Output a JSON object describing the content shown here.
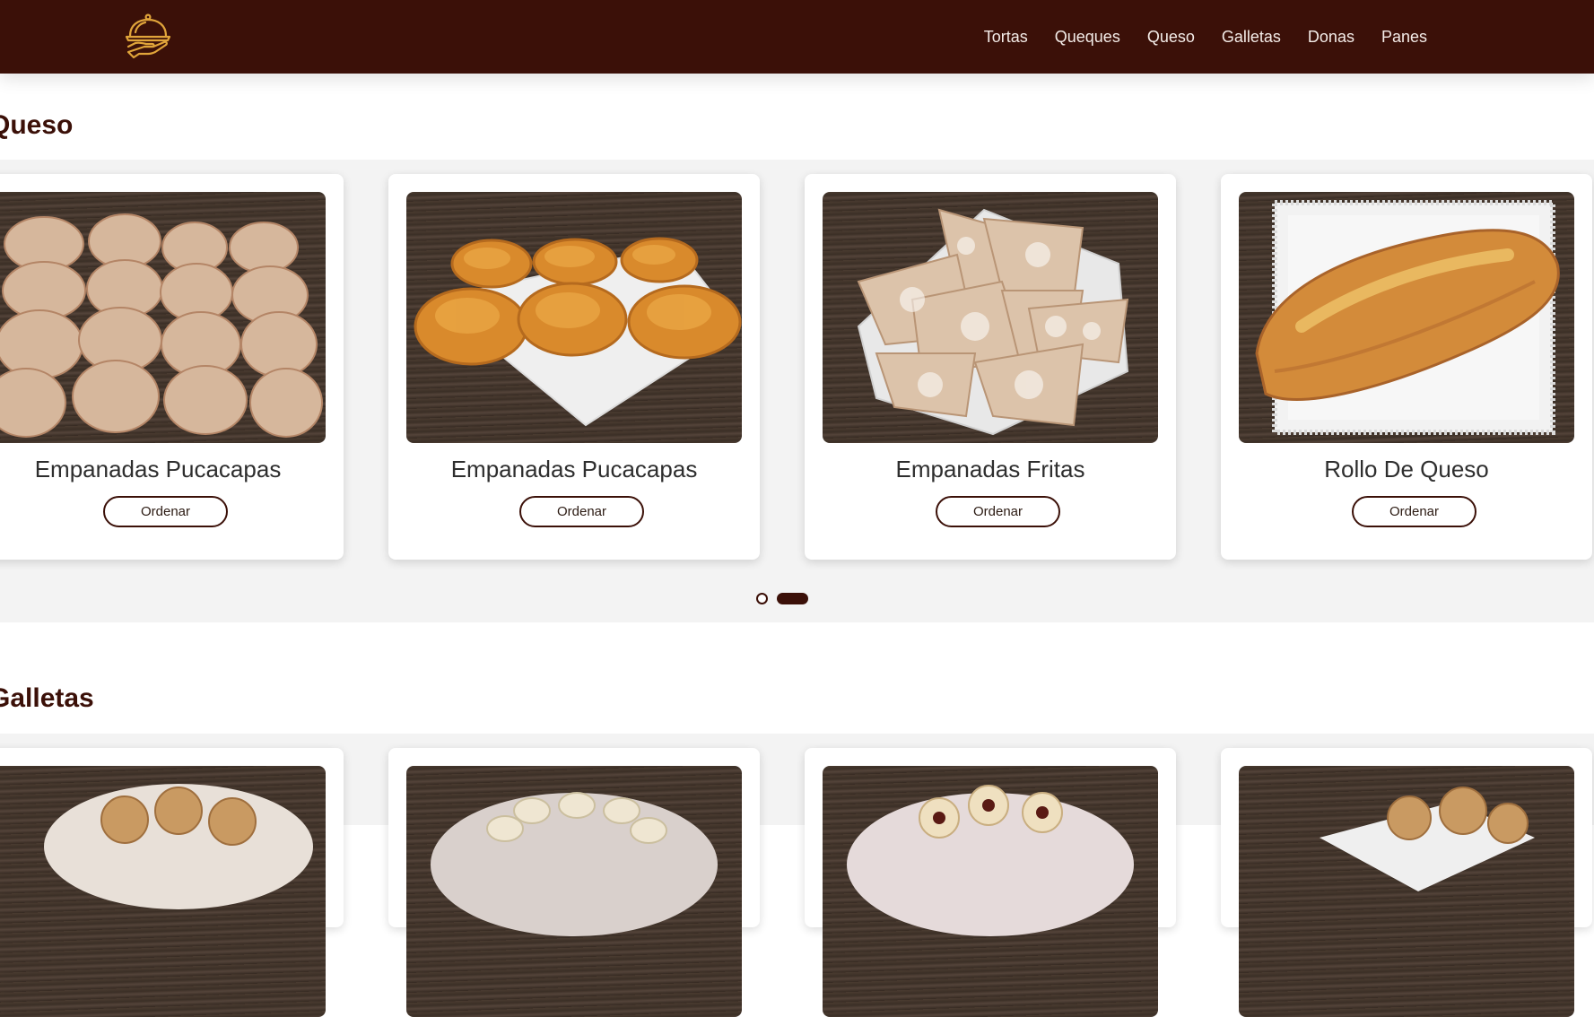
{
  "brand": {
    "logo_icon": "cloche-serving-icon",
    "logo_color": "#e0a43a"
  },
  "nav": {
    "items": [
      {
        "label": "Tortas"
      },
      {
        "label": "Queques"
      },
      {
        "label": "Queso"
      },
      {
        "label": "Galletas"
      },
      {
        "label": "Donas"
      },
      {
        "label": "Panes"
      }
    ]
  },
  "colors": {
    "primary": "#3b1008",
    "band": "#f3f3f3",
    "nav_text": "#f4ece8"
  },
  "sections": [
    {
      "title": "Queso",
      "cards": [
        {
          "title": "Empanadas Pucacapas",
          "button": "Ordenar"
        },
        {
          "title": "Empanadas Pucacapas",
          "button": "Ordenar"
        },
        {
          "title": "Empanadas Fritas",
          "button": "Ordenar"
        },
        {
          "title": "Rollo De Queso",
          "button": "Ordenar"
        }
      ],
      "carousel": {
        "pages": 2,
        "active_page": 2
      }
    },
    {
      "title": "Galletas"
    }
  ]
}
